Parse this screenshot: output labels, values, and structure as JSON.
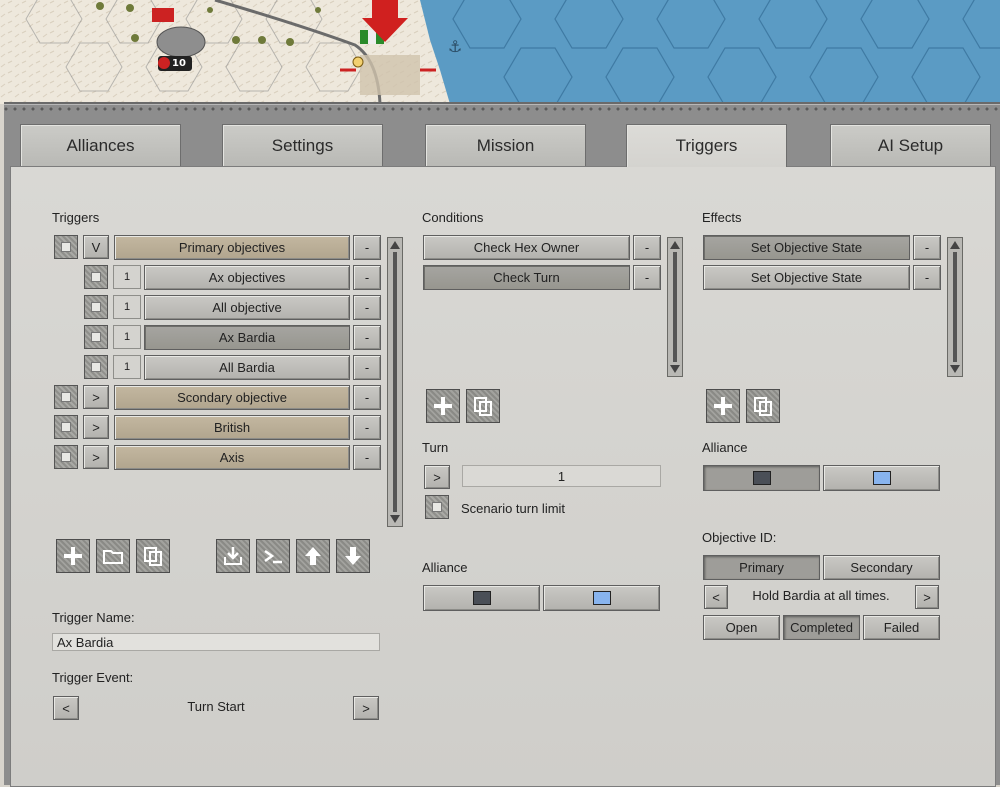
{
  "tabs": [
    "Alliances",
    "Settings",
    "Mission",
    "Triggers",
    "AI Setup"
  ],
  "active_tab": "Triggers",
  "triggers": {
    "heading": "Triggers",
    "rows": [
      {
        "toggle": "V",
        "label": "Primary objectives",
        "level": 0,
        "style": "tan"
      },
      {
        "count": "1",
        "label": "Ax objectives",
        "level": 1,
        "style": "grey"
      },
      {
        "count": "1",
        "label": "All objective",
        "level": 1,
        "style": "grey"
      },
      {
        "count": "1",
        "label": "Ax Bardia",
        "level": 1,
        "style": "dark"
      },
      {
        "count": "1",
        "label": "All Bardia",
        "level": 1,
        "style": "grey"
      },
      {
        "toggle": ">",
        "label": "Scondary objective",
        "level": 0,
        "style": "tan"
      },
      {
        "toggle": ">",
        "label": "British",
        "level": 0,
        "style": "tan"
      },
      {
        "toggle": ">",
        "label": "Axis",
        "level": 0,
        "style": "tan"
      }
    ],
    "remove_label": "-",
    "name_label": "Trigger Name:",
    "name_value": "Ax Bardia",
    "event_label": "Trigger Event:",
    "event_value": "Turn Start",
    "prev": "<",
    "next": ">"
  },
  "conditions": {
    "heading": "Conditions",
    "items": [
      "Check Hex Owner",
      "Check Turn"
    ],
    "remove_label": "-",
    "turn_label": "Turn",
    "turn_toggle": ">",
    "turn_value": "1",
    "scenario_limit": "Scenario turn limit",
    "alliance_label": "Alliance",
    "alliance_colors": [
      "#4a4f57",
      "#88b4ee"
    ]
  },
  "effects": {
    "heading": "Effects",
    "items": [
      "Set Objective State",
      "Set Objective State"
    ],
    "remove_label": "-",
    "alliance_label": "Alliance",
    "alliance_colors": [
      "#4a4f57",
      "#88b4ee"
    ],
    "objective_id_label": "Objective ID:",
    "primary": "Primary",
    "secondary": "Secondary",
    "prev": "<",
    "next": ">",
    "objective_text": "Hold Bardia at all times.",
    "open": "Open",
    "completed": "Completed",
    "failed": "Failed"
  },
  "map": {
    "unit_strength": "10"
  },
  "colors": {
    "sea": "#5b9bc4",
    "desert": "#ece6da",
    "tan_button": "#bcb09a",
    "panel": "#d3d2ce"
  }
}
